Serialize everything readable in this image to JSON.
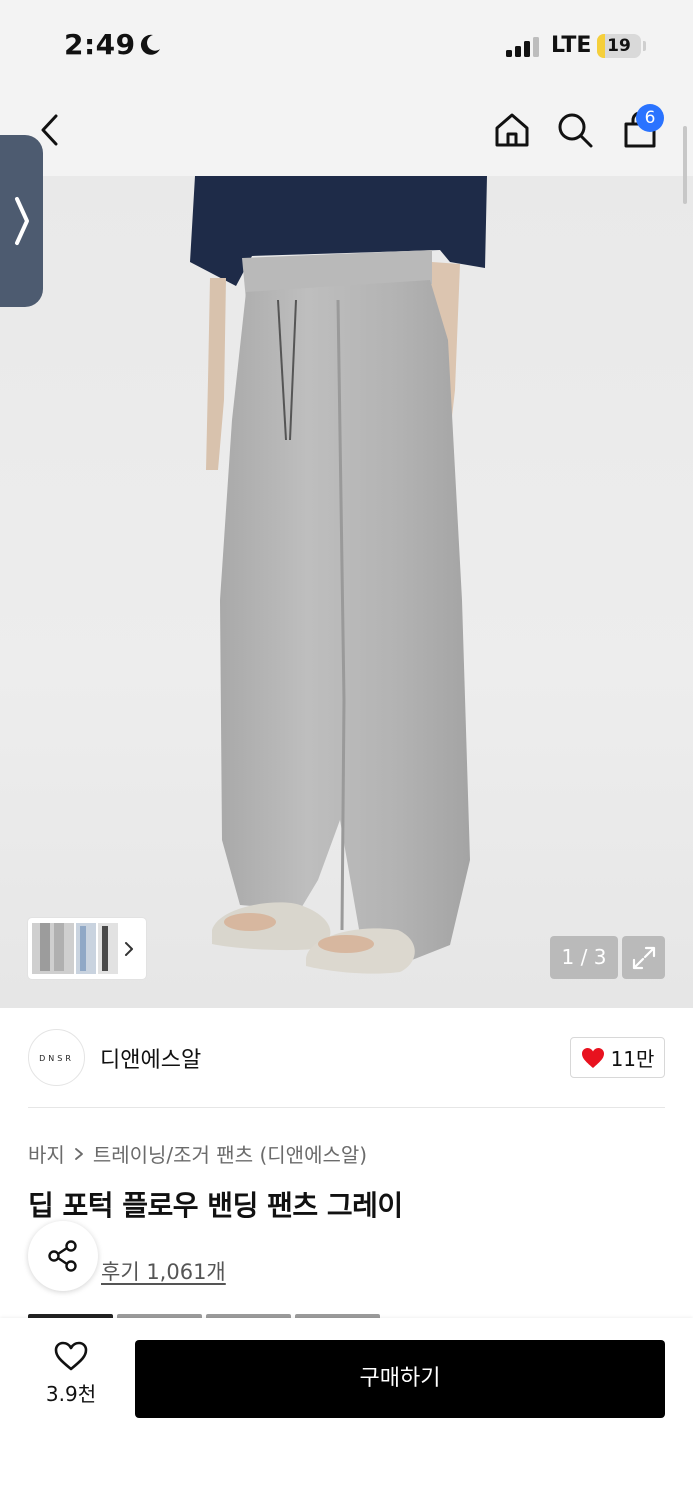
{
  "status_bar": {
    "time": "2:49",
    "network": "LTE",
    "battery_level": "19",
    "battery_fraction": 0.19,
    "moon_icon": "moon-icon",
    "signal_icon": "cellular-signal-icon"
  },
  "nav": {
    "back_icon": "chevron-left-icon",
    "home_icon": "home-icon",
    "search_icon": "search-icon",
    "cart_icon": "shopping-bag-icon",
    "cart_count": "6"
  },
  "gallery": {
    "counter": "1 / 3",
    "expand_icon": "expand-icon",
    "side_tab_icon": "chevron-right-icon"
  },
  "brand": {
    "logo_text": "DNSR",
    "name": "디앤에스알",
    "like_count": "11만"
  },
  "product": {
    "breadcrumb": [
      "바지",
      "트레이닝/조거 팬츠 (디앤에스알)"
    ],
    "title": "딥 포턱 플로우 밴딩 팬츠 그레이",
    "review_link": "후기 1,061개"
  },
  "bottom_bar": {
    "wish_count": "3.9천",
    "buy_label": "구매하기"
  },
  "colors": {
    "cart_badge": "#2a73ff",
    "heart": "#e8121f",
    "buy_button": "#000000",
    "side_tab": "#4d5b70",
    "battery": "#f5cf3b"
  }
}
